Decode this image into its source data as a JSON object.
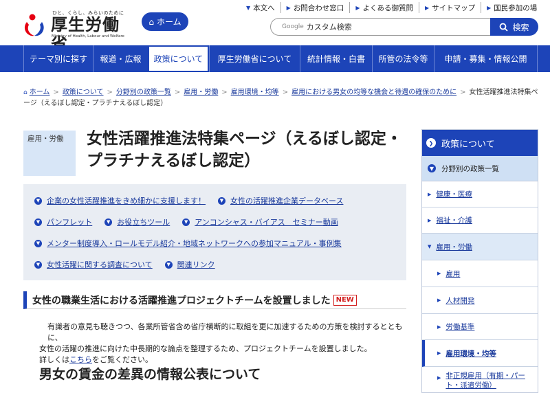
{
  "header": {
    "logo_tagline": "ひと、くらし、みらいのために",
    "logo_name": "厚生労働省",
    "logo_en": "Ministry of Health, Labour and Welfare",
    "home_label": "ホーム",
    "top_links": [
      "本文へ",
      "お問合わせ窓口",
      "よくある御質問",
      "サイトマップ",
      "国民参加の場"
    ],
    "search_google": "Google",
    "search_placeholder": "カスタム検索",
    "search_button": "検索"
  },
  "global_nav": [
    "テーマ別に探す",
    "報道・広報",
    "政策について",
    "厚生労働省について",
    "統計情報・白書",
    "所管の法令等",
    "申請・募集・情報公開"
  ],
  "breadcrumb": [
    "ホーム",
    "政策について",
    "分野別の政策一覧",
    "雇用・労働",
    "雇用環境・均等",
    "雇用における男女の均等な機会と待遇の確保のために",
    "女性活躍推進法特集ページ（えるぼし認定・プラチナえるぼし認定）"
  ],
  "category": "雇用・労働",
  "page_title": "女性活躍推進法特集ページ（えるぼし認定・プラチナえるぼし認定）",
  "quick_links": [
    [
      "企業の女性活躍推進をきめ細かに支援します！",
      "女性の活躍推進企業データベース"
    ],
    [
      "パンフレット",
      "お役立ちツール",
      "アンコンシャス・バイアス　セミナー動画"
    ],
    [
      "メンター制度導入・ロールモデル紹介・地域ネットワークへの参加マニュアル・事例集"
    ],
    [
      "女性活躍に関する調査について",
      "関連リンク"
    ]
  ],
  "section1": {
    "heading": "女性の職業生活における活躍推進プロジェクトチームを設置しました",
    "badge": "NEW",
    "line1": "有識者の意見も聴きつつ、各業所管省含め省庁横断的に取組を更に加速するための方策を検討するとともに、",
    "line2": "女性の活躍の推進に向けた中長期的な論点を整理するため、プロジェクトチームを設置しました。",
    "line3_prefix": "詳しくは",
    "line3_link": "こちら",
    "line3_suffix": "をご覧ください。"
  },
  "section2_heading": "男女の賃金の差異の情報公表について",
  "sidebar": {
    "title": "政策について",
    "sub": "分野別の政策一覧",
    "items": [
      "健康・医療",
      "福祉・介護",
      "雇用・労働",
      "雇用",
      "人材開発",
      "労働基準",
      "雇用環境・均等",
      "非正規雇用（有期・パート・派遣労働）"
    ]
  },
  "colors": {
    "primary": "#1d44b8",
    "badge": "#d32020",
    "panel": "#e9edf3"
  }
}
